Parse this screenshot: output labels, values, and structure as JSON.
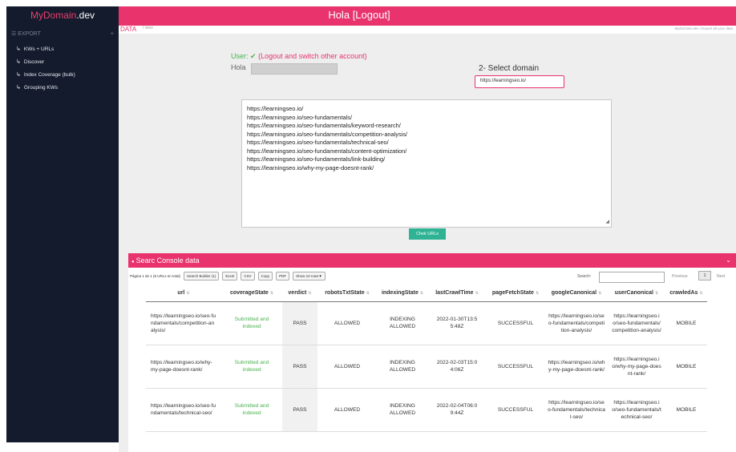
{
  "brand": {
    "part1": "MyDomain",
    "part2": ".dev"
  },
  "sidebar": {
    "section": "EXPORT",
    "section_action": "+",
    "items": [
      {
        "label": "KWs + URLs"
      },
      {
        "label": "Discover"
      },
      {
        "label": "Index Coverage (bulk)"
      },
      {
        "label": "Grouping KWs"
      }
    ]
  },
  "topbar": {
    "greeting": "Hola",
    "logout": "[Logout]"
  },
  "breadcrumb": {
    "current": "DATA",
    "sub": "/  view",
    "right": "MyDomain.dev  /  Export all your data"
  },
  "user": {
    "label": "User:",
    "check": "✔",
    "switch_text": "(Logout and switch other account)",
    "hola": "Hola"
  },
  "domain": {
    "label": "2- Select domain",
    "selected": "https://learningseo.io/"
  },
  "urls": [
    "https://learningseo.io/",
    "https://learningseo.io/seo-fundamentals/",
    "https://learningseo.io/seo-fundamentals/keyword-research/",
    "https://learningseo.io/seo-fundamentals/competition-analysis/",
    "https://learningseo.io/seo-fundamentals/technical-seo/",
    "https://learningseo.io/seo-fundamentals/content-optimization/",
    "https://learningseo.io/seo-fundamentals/link-building/",
    "https://learningseo.io/why-my-page-doesnt-rank/"
  ],
  "chek_button": "Chek URLs",
  "panel": {
    "title": "Searc Console data",
    "toolbar": {
      "info": "Página 1 de 1 (8 URLs en total)",
      "buttons": [
        "Search Builder (1)",
        "Excel",
        "CSV",
        "Copy",
        "PDF",
        "Show 10 rows▼"
      ]
    },
    "search_label": "Search:",
    "previous": "Previous",
    "page": "1",
    "next": "Next"
  },
  "table": {
    "headers": [
      "url",
      "coverageState",
      "verdict",
      "robotsTxtState",
      "indexingState",
      "lastCrawlTime",
      "pageFetchState",
      "googleCanonical",
      "userCanonical",
      "crawledAs"
    ],
    "rows": [
      [
        "https://learningseo.io/seo-fundamentals/competition-analysis/",
        "Submitted and indexed",
        "PASS",
        "ALLOWED",
        "INDEXING ALLOWED",
        "2022-01-30T13:55:48Z",
        "SUCCESSFUL",
        "https://learningseo.io/seo-fundamentals/competition-analysis/",
        "https://learningseo.io/seo-fundamentals/competition-analysis/",
        "MOBILE"
      ],
      [
        "https://learningseo.io/why-my-page-doesnt-rank/",
        "Submitted and indexed",
        "PASS",
        "ALLOWED",
        "INDEXING ALLOWED",
        "2022-02-03T15:04:06Z",
        "SUCCESSFUL",
        "https://learningseo.io/why-my-page-doesnt-rank/",
        "https://learningseo.io/why-my-page-doesnt-rank/",
        "MOBILE"
      ],
      [
        "https://learningseo.io/seo-fundamentals/technical-seo/",
        "Submitted and indexed",
        "PASS",
        "ALLOWED",
        "INDEXING ALLOWED",
        "2022-02-04T06:09:44Z",
        "SUCCESSFUL",
        "https://learningseo.io/seo-fundamentals/technical-seo/",
        "https://learningseo.io/seo-fundamentals/technical-seo/",
        "MOBILE"
      ]
    ]
  },
  "colors": {
    "accent": "#e8336d",
    "sidebar": "#141b2d",
    "success": "#47b34c",
    "button": "#2eb394"
  }
}
